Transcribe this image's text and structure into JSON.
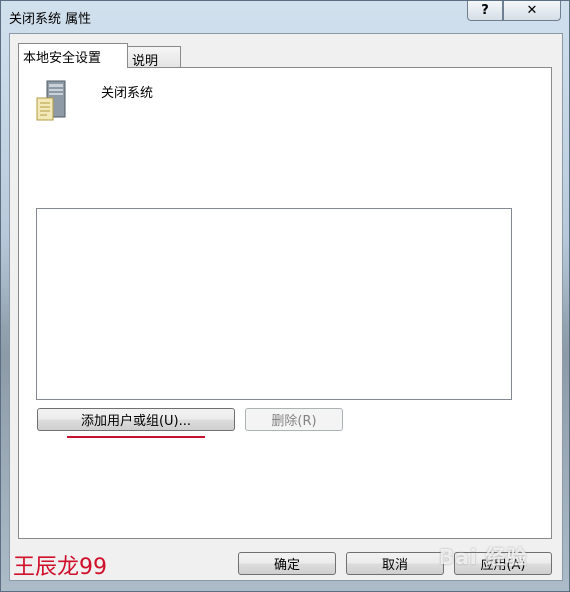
{
  "window": {
    "title": "关闭系统 属性",
    "help_label": "?",
    "close_label": "✕"
  },
  "tabs": [
    {
      "label": "本地安全设置",
      "active": true
    },
    {
      "label": "说明",
      "active": false
    }
  ],
  "policy": {
    "name": "关闭系统",
    "icon": "server-policy-icon"
  },
  "listbox": {
    "items": []
  },
  "buttons": {
    "add_label": "添加用户或组(U)...",
    "remove_label": "删除(R)",
    "ok_label": "确定",
    "cancel_label": "取消",
    "apply_label": "应用(A)"
  },
  "watermark": {
    "author": "王辰龙99",
    "site": "Bai 经验"
  },
  "colors": {
    "annotation_red": "#c8102e"
  }
}
